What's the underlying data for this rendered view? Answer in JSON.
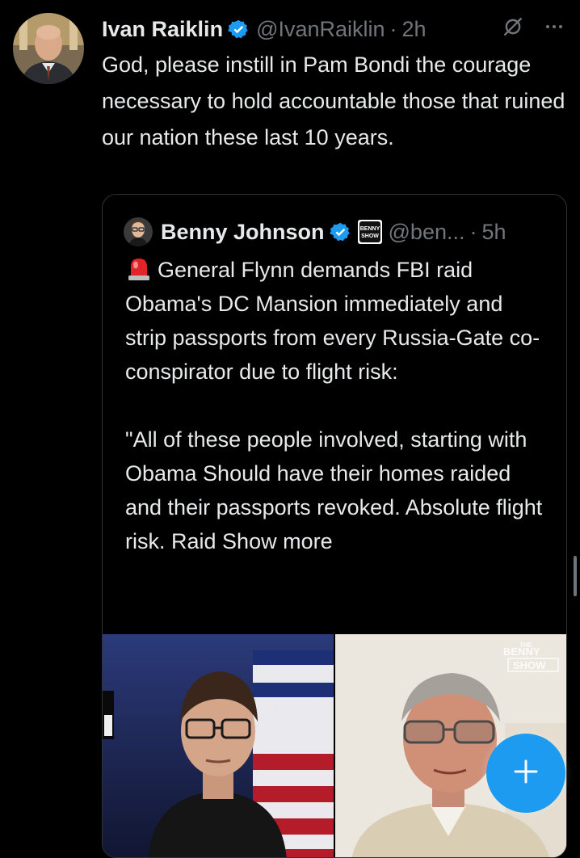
{
  "tweet": {
    "display_name": "Ivan Raiklin",
    "handle": "@IvanRaiklin",
    "separator": "·",
    "time": "2h",
    "more_icon": "more-horizontal-icon",
    "grok_icon": "grok-icon",
    "text": "God, please instill in Pam Bondi the courage necessary to hold accountable those that ruined our nation these last 10 years."
  },
  "quote": {
    "display_name": "Benny Johnson",
    "handle": "@ben...",
    "separator": "·",
    "time": "5h",
    "affiliate_badge_text": [
      "BENNY",
      "SHOW"
    ],
    "paragraph1": "General Flynn demands FBI raid Obama's DC Mansion immediately and strip passports from every Russia-Gate co-conspirator due to flight risk:",
    "paragraph2": "\"All of these people involved, starting with Obama Should have their homes raided and their passports revoked. Absolute flight risk. Raid",
    "show_more": "Show more",
    "media_watermark": [
      "THE",
      "BENNY",
      "SHOW"
    ]
  },
  "fab": {
    "icon": "plus-icon"
  },
  "colors": {
    "background": "#000000",
    "text": "#e7e9ea",
    "secondary_text": "#71767b",
    "border": "#2f3336",
    "accent": "#1d9bf0"
  }
}
